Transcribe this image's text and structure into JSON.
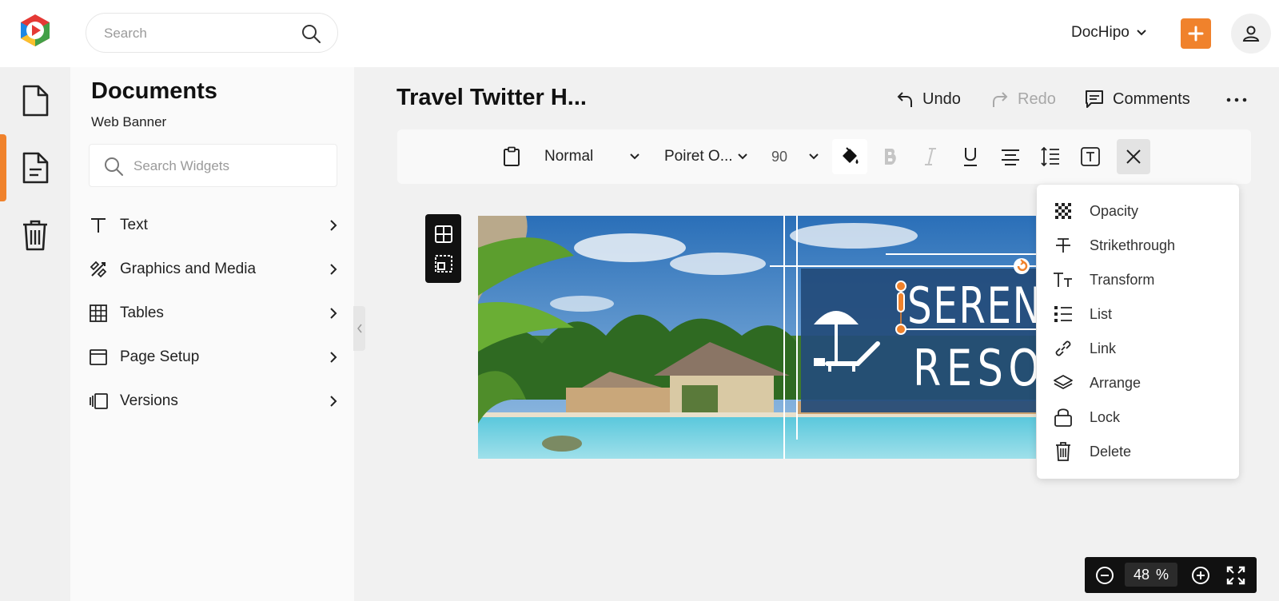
{
  "header": {
    "search_placeholder": "Search",
    "account_label": "DocHipo",
    "brand_colors": {
      "accent": "#f0822c"
    }
  },
  "rail": {
    "items": [
      {
        "icon": "document-icon",
        "active": false
      },
      {
        "icon": "document-lines-icon",
        "active": true
      },
      {
        "icon": "trash-icon",
        "active": false
      }
    ]
  },
  "panel": {
    "title": "Documents",
    "subtitle": "Web Banner",
    "search_placeholder": "Search Widgets",
    "items": [
      {
        "label": "Text",
        "icon": "text-icon"
      },
      {
        "label": "Graphics and Media",
        "icon": "graphics-icon"
      },
      {
        "label": "Tables",
        "icon": "table-icon"
      },
      {
        "label": "Page Setup",
        "icon": "page-setup-icon"
      },
      {
        "label": "Versions",
        "icon": "versions-icon"
      }
    ]
  },
  "editor": {
    "doc_title": "Travel Twitter H...",
    "undo_label": "Undo",
    "redo_label": "Redo",
    "comments_label": "Comments"
  },
  "toolbar": {
    "style_value": "Normal",
    "font_value": "Poiret O...",
    "size_value": "90"
  },
  "banner": {
    "line1": "SERENE",
    "line2": "RESO"
  },
  "context_menu": {
    "items": [
      {
        "label": "Opacity",
        "icon": "opacity-icon"
      },
      {
        "label": "Strikethrough",
        "icon": "strikethrough-icon"
      },
      {
        "label": "Transform",
        "icon": "transform-icon"
      },
      {
        "label": "List",
        "icon": "list-icon"
      },
      {
        "label": "Link",
        "icon": "link-icon"
      },
      {
        "label": "Arrange",
        "icon": "layers-icon"
      },
      {
        "label": "Lock",
        "icon": "lock-icon"
      },
      {
        "label": "Delete",
        "icon": "trash-icon"
      }
    ]
  },
  "zoom": {
    "value": "48",
    "unit": "%"
  }
}
